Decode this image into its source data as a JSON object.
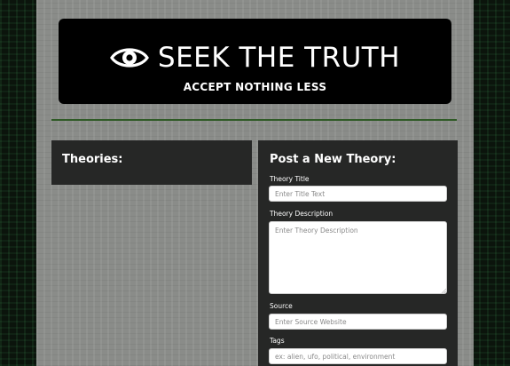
{
  "header": {
    "title": "SEEK THE TRUTH",
    "subtitle": "ACCEPT NOTHING LESS",
    "icon": "eye-icon"
  },
  "theories": {
    "heading": "Theories:"
  },
  "form": {
    "heading": "Post a New Theory:",
    "title_label": "Theory Title",
    "title_placeholder": "Enter Title Text",
    "description_label": "Theory Description",
    "description_placeholder": "Enter Theory Description",
    "source_label": "Source",
    "source_placeholder": "Enter Source Website",
    "tags_label": "Tags",
    "tags_placeholder": "ex: alien, ufo, political, environment"
  },
  "colors": {
    "hero_background": "#000000",
    "panel_background": "#262726",
    "divider": "#2f5a26",
    "page_background": "#8a8c89"
  }
}
